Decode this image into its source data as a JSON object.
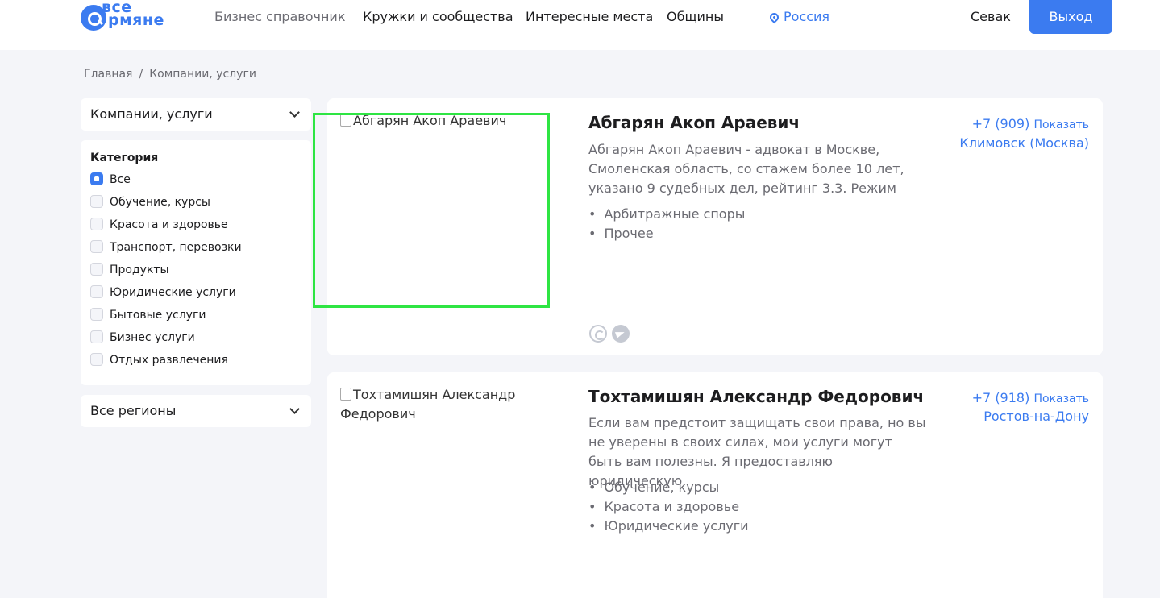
{
  "header": {
    "logo_line1": "все",
    "logo_line2": "рмяне",
    "nav": [
      "Бизнес справочник",
      "Кружки и сообщества",
      "Интересные места",
      "Общины"
    ],
    "region": "Россия",
    "user": "Севак",
    "exit_label": "Выход"
  },
  "breadcrumb": {
    "home": "Главная",
    "separator": "/",
    "current": "Компании, услуги"
  },
  "sidebar": {
    "type_select": "Компании, услуги",
    "category_title": "Категория",
    "categories": [
      {
        "label": "Все",
        "checked": true
      },
      {
        "label": "Обучение, курсы",
        "checked": false
      },
      {
        "label": "Красота и здоровье",
        "checked": false
      },
      {
        "label": "Транспорт, перевозки",
        "checked": false
      },
      {
        "label": "Продукты",
        "checked": false
      },
      {
        "label": "Юридические услуги",
        "checked": false
      },
      {
        "label": "Бытовые услуги",
        "checked": false
      },
      {
        "label": "Бизнес услуги",
        "checked": false
      },
      {
        "label": "Отдых развлечения",
        "checked": false
      }
    ],
    "region_select": "Все регионы"
  },
  "listings": [
    {
      "image_alt": "Абгарян Акоп Араевич",
      "name": "Абгарян Акоп Араевич",
      "description": "Абгарян Акоп Араевич - адвокат в Москве, Смоленская область, со стажем более 10 лет, указано 9 судебных дел, рейтинг 3.3. Режим",
      "tags": [
        "Арбитражные споры",
        "Прочее"
      ],
      "phone": "+7 (909)",
      "show_label": "Показать",
      "city": "Климовск (Москва)",
      "icons": [
        "whatsapp-icon",
        "telegram-icon"
      ]
    },
    {
      "image_alt": "Тохтамишян Александр Федорович",
      "name": "Тохтамишян Александр Федорович",
      "description": "Если вам предстоит защищать свои права, но вы не уверены в своих силах, мои услуги могут быть вам полезны. Я предоставляю юридическую",
      "tags": [
        "Обучение, курсы",
        "Красота и здоровье",
        "Юридические услуги"
      ],
      "phone": "+7 (918)",
      "show_label": "Показать",
      "city": "Ростов-на-Дону"
    }
  ],
  "colors": {
    "accent": "#3b7bf0",
    "page_bg": "#f4f5f9",
    "highlight": "#2ee543"
  }
}
